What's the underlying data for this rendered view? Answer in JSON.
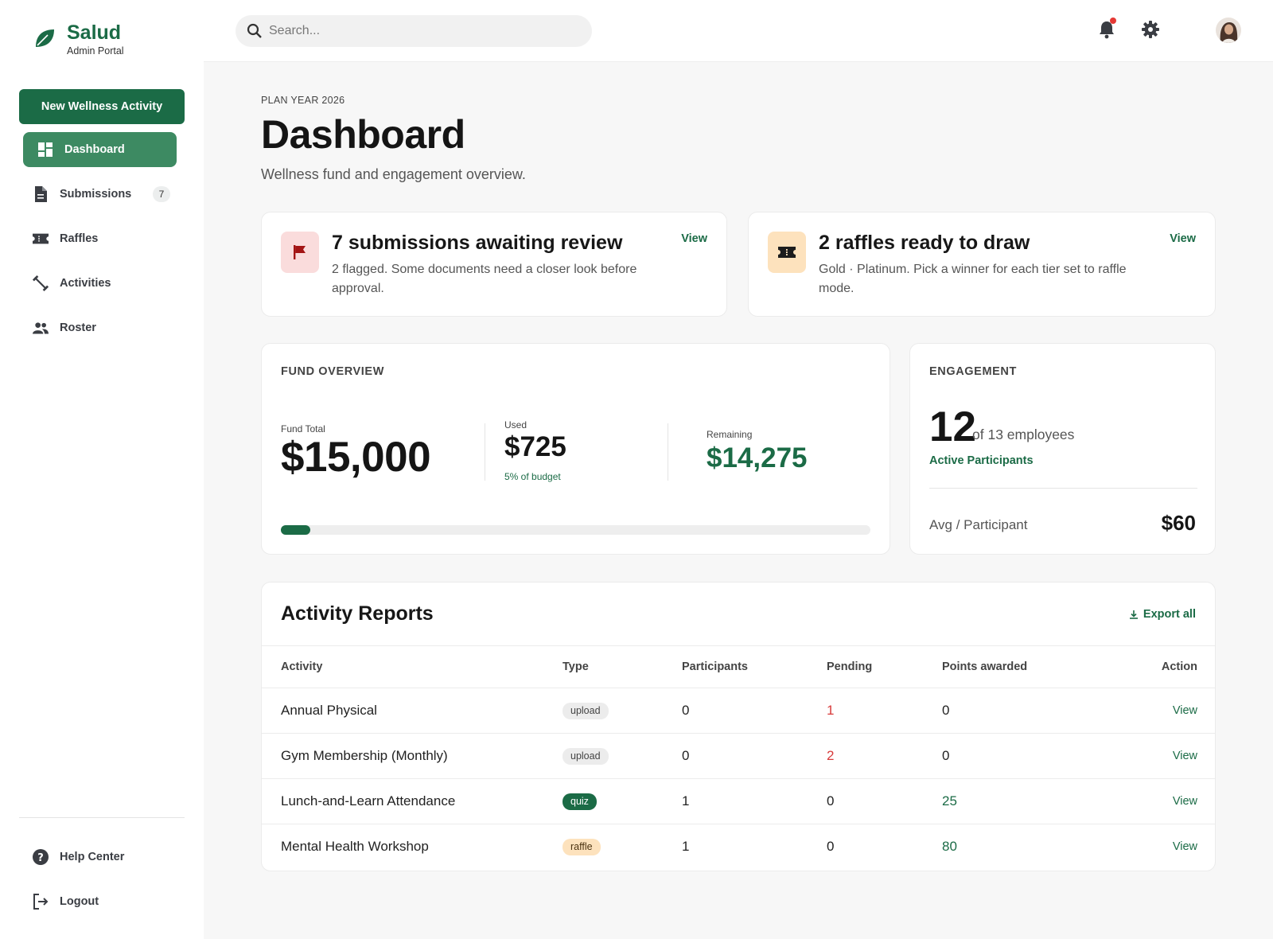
{
  "brand": {
    "name": "Salud",
    "subtitle": "Admin Portal"
  },
  "sidebar": {
    "new_activity_label": "New Wellness Activity",
    "items": [
      {
        "label": "Dashboard",
        "icon": "dashboard-icon",
        "active": true
      },
      {
        "label": "Submissions",
        "icon": "document-icon",
        "badge": "7"
      },
      {
        "label": "Raffles",
        "icon": "ticket-icon"
      },
      {
        "label": "Activities",
        "icon": "dumbbell-icon"
      },
      {
        "label": "Roster",
        "icon": "people-icon"
      }
    ],
    "bottom": [
      {
        "label": "Help Center",
        "icon": "help-icon"
      },
      {
        "label": "Logout",
        "icon": "logout-icon"
      }
    ]
  },
  "topbar": {
    "search_placeholder": "Search..."
  },
  "header": {
    "eyebrow": "PLAN YEAR 2026",
    "title": "Dashboard",
    "subtitle": "Wellness fund and engagement overview."
  },
  "alerts": [
    {
      "title": "7 submissions awaiting review",
      "body": "2 flagged. Some documents need a closer look before approval.",
      "view_label": "View",
      "icon": "flag-icon",
      "icon_bg": "#fadcdc",
      "icon_color": "#a31515"
    },
    {
      "title": "2 raffles ready to draw",
      "body": "Gold · Platinum. Pick a winner for each tier set to raffle mode.",
      "view_label": "View",
      "icon": "ticket-icon",
      "icon_bg": "#fde2bd",
      "icon_color": "#1c1c1c"
    }
  ],
  "fund": {
    "label": "FUND OVERVIEW",
    "total_label": "Fund Total",
    "total_value": "$15,000",
    "used_label": "Used",
    "used_value": "$725",
    "used_pct": "5% of budget",
    "remaining_label": "Remaining",
    "remaining_value": "$14,275",
    "progress_fraction": 0.05
  },
  "engagement": {
    "label": "ENGAGEMENT",
    "count": "12",
    "of_text": "of 13 employees",
    "active_label": "Active Participants",
    "avg_label": "Avg / Participant",
    "avg_value": "$60"
  },
  "reports": {
    "title": "Activity Reports",
    "export_label": "Export all",
    "columns": [
      "Activity",
      "Type",
      "Participants",
      "Pending",
      "Points awarded",
      "Action"
    ],
    "rows": [
      {
        "activity": "Annual Physical",
        "type": "upload",
        "participants": "0",
        "pending": "1",
        "points": "0",
        "action": "View"
      },
      {
        "activity": "Gym Membership (Monthly)",
        "type": "upload",
        "participants": "0",
        "pending": "2",
        "points": "0",
        "action": "View"
      },
      {
        "activity": "Lunch-and-Learn Attendance",
        "type": "quiz",
        "participants": "1",
        "pending": "0",
        "points": "25",
        "action": "View"
      },
      {
        "activity": "Mental Health Workshop",
        "type": "raffle",
        "participants": "1",
        "pending": "0",
        "points": "80",
        "action": "View"
      }
    ]
  },
  "colors": {
    "brand": "#1b6b46",
    "brand_light": "#3d8a62",
    "danger": "#d83b3b"
  }
}
